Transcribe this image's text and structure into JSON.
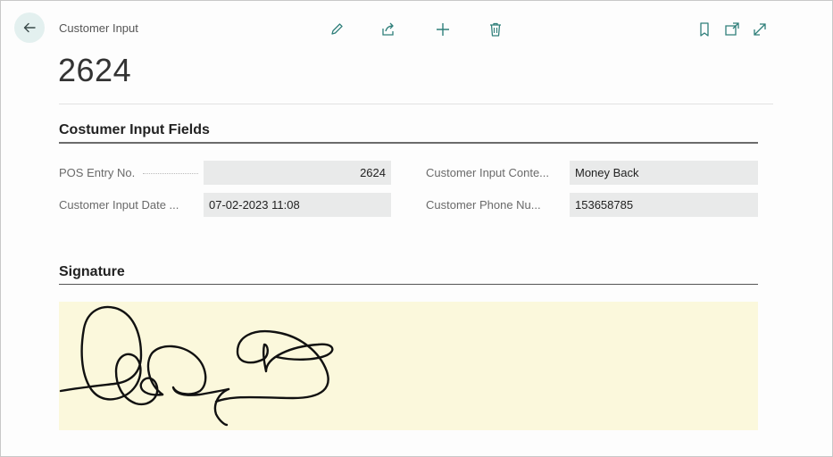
{
  "header": {
    "breadcrumb": "Customer Input",
    "record_title": "2624"
  },
  "toolbar": {
    "icons": [
      "edit-icon",
      "share-icon",
      "add-icon",
      "delete-icon",
      "bookmark-icon",
      "open-new-window-icon",
      "expand-icon"
    ]
  },
  "sections": {
    "fields_title": "Costumer Input Fields",
    "signature_title": "Signature"
  },
  "fields": {
    "pos_entry_no": {
      "label": "POS Entry No.",
      "value": "2624"
    },
    "customer_input_date": {
      "label": "Customer Input Date ...",
      "value": "07-02-2023 11:08"
    },
    "customer_input_context": {
      "label": "Customer Input Conte...",
      "value": "Money Back"
    },
    "customer_phone": {
      "label": "Customer Phone Nu...",
      "value": "153658785"
    }
  },
  "colors": {
    "back_button_bg": "#e3f0ef",
    "field_bg": "#e9eaea",
    "signature_bg": "#fbf8dc",
    "icon_color": "#2f7f7a"
  }
}
